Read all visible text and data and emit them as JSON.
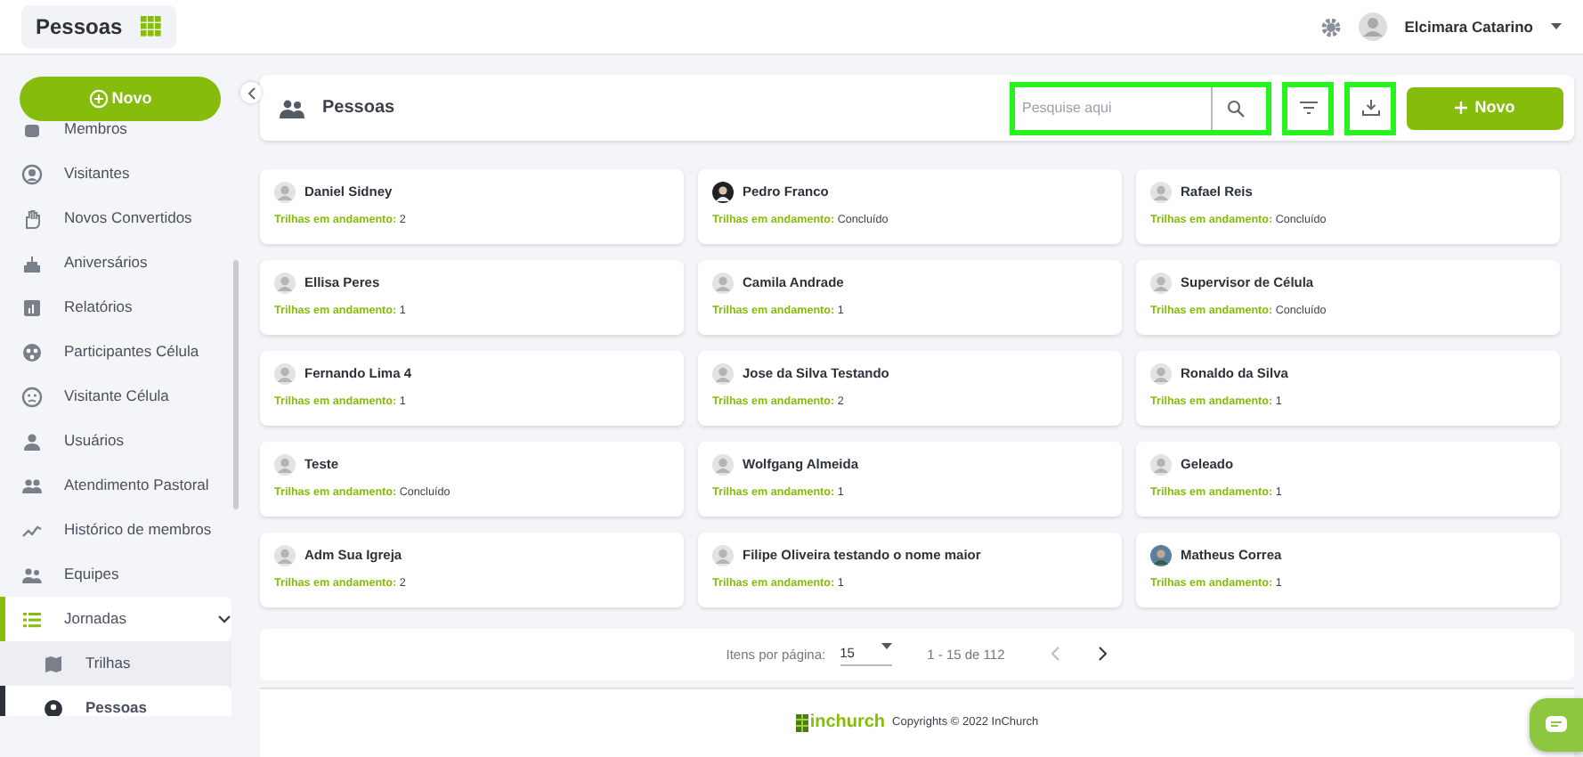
{
  "topbar": {
    "title": "Pessoas",
    "user": "Elcimara Catarino"
  },
  "sidebar": {
    "new_button": "Novo",
    "items": [
      {
        "label": "Membros",
        "selected": false
      },
      {
        "label": "Visitantes",
        "selected": false
      },
      {
        "label": "Novos Convertidos",
        "selected": false
      },
      {
        "label": "Aniversários",
        "selected": false
      },
      {
        "label": "Relatórios",
        "selected": false
      },
      {
        "label": "Participantes Célula",
        "selected": false
      },
      {
        "label": "Visitante Célula",
        "selected": false
      },
      {
        "label": "Usuários",
        "selected": false
      },
      {
        "label": "Atendimento Pastoral",
        "selected": false
      },
      {
        "label": "Histórico de membros",
        "selected": false
      },
      {
        "label": "Equipes",
        "selected": false
      },
      {
        "label": "Jornadas",
        "selected": false,
        "expanded": true,
        "children": [
          {
            "label": "Trilhas",
            "selected": false
          },
          {
            "label": "Pessoas",
            "selected": true
          }
        ]
      }
    ]
  },
  "header": {
    "title": "Pessoas",
    "search": {
      "placeholder": "Pesquise aqui",
      "highlighted": true
    },
    "filter_highlighted": true,
    "download_highlighted": true,
    "new_button": "Novo"
  },
  "people": [
    {
      "name": "Daniel Sidney",
      "label": "Trilhas em andamento:",
      "value": "2",
      "kind": "default"
    },
    {
      "name": "Pedro Franco",
      "label": "Trilhas em andamento:",
      "value": "Concluído",
      "kind": "photo"
    },
    {
      "name": "Rafael Reis",
      "label": "Trilhas em andamento:",
      "value": "Concluído",
      "kind": "default"
    },
    {
      "name": "Ellisa Peres",
      "label": "Trilhas em andamento:",
      "value": "1",
      "kind": "default"
    },
    {
      "name": "Camila Andrade",
      "label": "Trilhas em andamento:",
      "value": "1",
      "kind": "default"
    },
    {
      "name": "Supervisor de Célula",
      "label": "Trilhas em andamento:",
      "value": "Concluído",
      "kind": "default"
    },
    {
      "name": "Fernando Lima 4",
      "label": "Trilhas em andamento:",
      "value": "1",
      "kind": "default"
    },
    {
      "name": "Jose da Silva Testando",
      "label": "Trilhas em andamento:",
      "value": "2",
      "kind": "default"
    },
    {
      "name": "Ronaldo da Silva",
      "label": "Trilhas em andamento:",
      "value": "1",
      "kind": "default"
    },
    {
      "name": "Teste",
      "label": "Trilhas em andamento:",
      "value": "Concluído",
      "kind": "default"
    },
    {
      "name": "Wolfgang Almeida",
      "label": "Trilhas em andamento:",
      "value": "1",
      "kind": "default"
    },
    {
      "name": "Geleado",
      "label": "Trilhas em andamento:",
      "value": "1",
      "kind": "default"
    },
    {
      "name": "Adm Sua Igreja",
      "label": "Trilhas em andamento:",
      "value": "2",
      "kind": "default"
    },
    {
      "name": "Filipe Oliveira testando o nome maior",
      "label": "Trilhas em andamento:",
      "value": "1",
      "kind": "default"
    },
    {
      "name": "Matheus Correa",
      "label": "Trilhas em andamento:",
      "value": "1",
      "kind": "photo2"
    }
  ],
  "pagination": {
    "label": "Itens por página:",
    "per_page": "15",
    "range": "1 - 15 de 112"
  },
  "footer": {
    "brand": "inchurch",
    "copyright": "Copyrights © 2022 InChurch"
  }
}
